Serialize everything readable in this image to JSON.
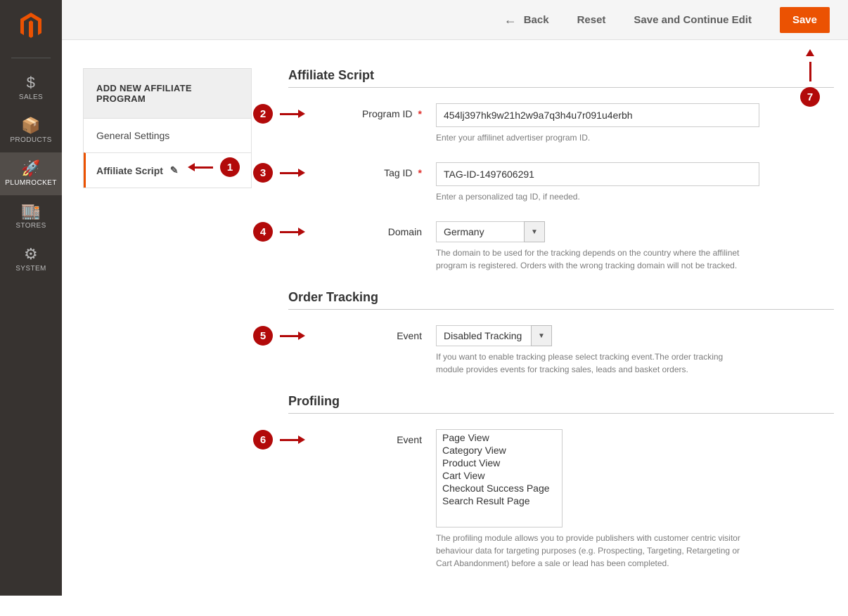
{
  "nav": {
    "items": [
      {
        "glyph": "$",
        "label": "SALES"
      },
      {
        "glyph": "📦",
        "label": "PRODUCTS"
      },
      {
        "glyph": "🚀",
        "label": "PLUMROCKET"
      },
      {
        "glyph": "🏬",
        "label": "STORES"
      },
      {
        "glyph": "⚙",
        "label": "SYSTEM"
      }
    ]
  },
  "topbar": {
    "back": "Back",
    "reset": "Reset",
    "save_continue": "Save and Continue Edit",
    "save": "Save"
  },
  "tabs": {
    "header": "ADD NEW AFFILIATE PROGRAM",
    "general": "General Settings",
    "script": "Affiliate Script"
  },
  "sections": {
    "affiliate": {
      "title": "Affiliate Script",
      "program_id": {
        "label": "Program ID",
        "value": "454lj397hk9w21h2w9a7q3h4u7r091u4erbh",
        "help": "Enter your affilinet advertiser program ID."
      },
      "tag_id": {
        "label": "Tag ID",
        "value": "TAG-ID-1497606291",
        "help": "Enter a personalized tag ID, if needed."
      },
      "domain": {
        "label": "Domain",
        "value": "Germany",
        "help": "The domain to be used for the tracking depends on the country where the affilinet program is registered. Orders with the wrong tracking domain will not be tracked."
      }
    },
    "order_tracking": {
      "title": "Order Tracking",
      "event": {
        "label": "Event",
        "value": "Disabled Tracking",
        "help": "If you want to enable tracking please select tracking event.The order tracking module provides events for tracking sales, leads and basket orders."
      }
    },
    "profiling": {
      "title": "Profiling",
      "event": {
        "label": "Event",
        "options": [
          "Page View",
          "Category View",
          "Product View",
          "Cart View",
          "Checkout Success Page",
          "Search Result Page"
        ],
        "help": "The profiling module allows you to provide publishers with customer centric visitor behaviour data for targeting purposes (e.g. Prospecting, Targeting, Retargeting or Cart Abandonment) before a sale or lead has been completed."
      }
    }
  },
  "badges": {
    "1": "1",
    "2": "2",
    "3": "3",
    "4": "4",
    "5": "5",
    "6": "6",
    "7": "7"
  }
}
